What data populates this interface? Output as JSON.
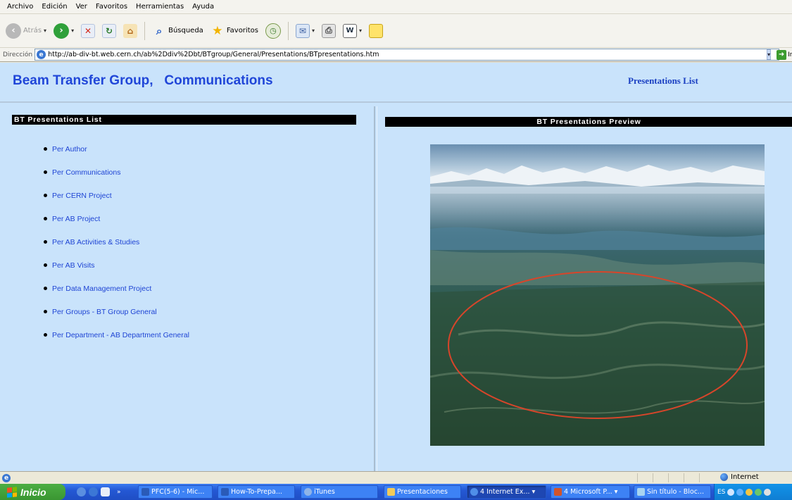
{
  "browser": {
    "menu": [
      "Archivo",
      "Edición",
      "Ver",
      "Favoritos",
      "Herramientas",
      "Ayuda"
    ],
    "toolbar": {
      "back_label": "Atrás",
      "search_label": "Búsqueda",
      "favorites_label": "Favoritos"
    },
    "address": {
      "label": "Dirección",
      "url": "http://ab-div-bt.web.cern.ch/ab%2Ddiv%2Dbt/BTgroup/General/Presentations/BTpresentations.htm",
      "go_label": "Ir"
    },
    "status": {
      "zone": "Internet"
    }
  },
  "page": {
    "title": "Beam Transfer Group,   Communications",
    "header_link": "Presentations List",
    "left_heading": "BT Presentations List",
    "right_heading": "BT Presentations Preview",
    "list_items": [
      "Per Author",
      "Per Communications",
      "Per CERN Project",
      "Per AB Project",
      "Per AB Activities & Studies",
      "Per AB Visits",
      "Per Data Management Project",
      "Per Groups - BT Group General",
      "Per Department - AB Department General"
    ]
  },
  "taskbar": {
    "start_label": "Inicio",
    "tasks": [
      {
        "label": "PFC(5-6) - Mic...",
        "icon": "word-icon"
      },
      {
        "label": "How-To-Prepa...",
        "icon": "word-icon"
      },
      {
        "label": "iTunes",
        "icon": "itunes-icon"
      },
      {
        "label": "Presentaciones",
        "icon": "folder-icon"
      },
      {
        "label": "4 Internet Ex...",
        "icon": "ie-icon"
      },
      {
        "label": "4 Microsoft P...",
        "icon": "powerpoint-icon"
      },
      {
        "label": "Sin título - Bloc...",
        "icon": "notepad-icon"
      }
    ],
    "tray_lang": "ES"
  },
  "colors": {
    "page_background": "#c9e3fb",
    "title_blue": "#2046d8",
    "link_blue": "#1e44d4",
    "heading_bar": "#000000",
    "ring_red": "#d8452a"
  }
}
